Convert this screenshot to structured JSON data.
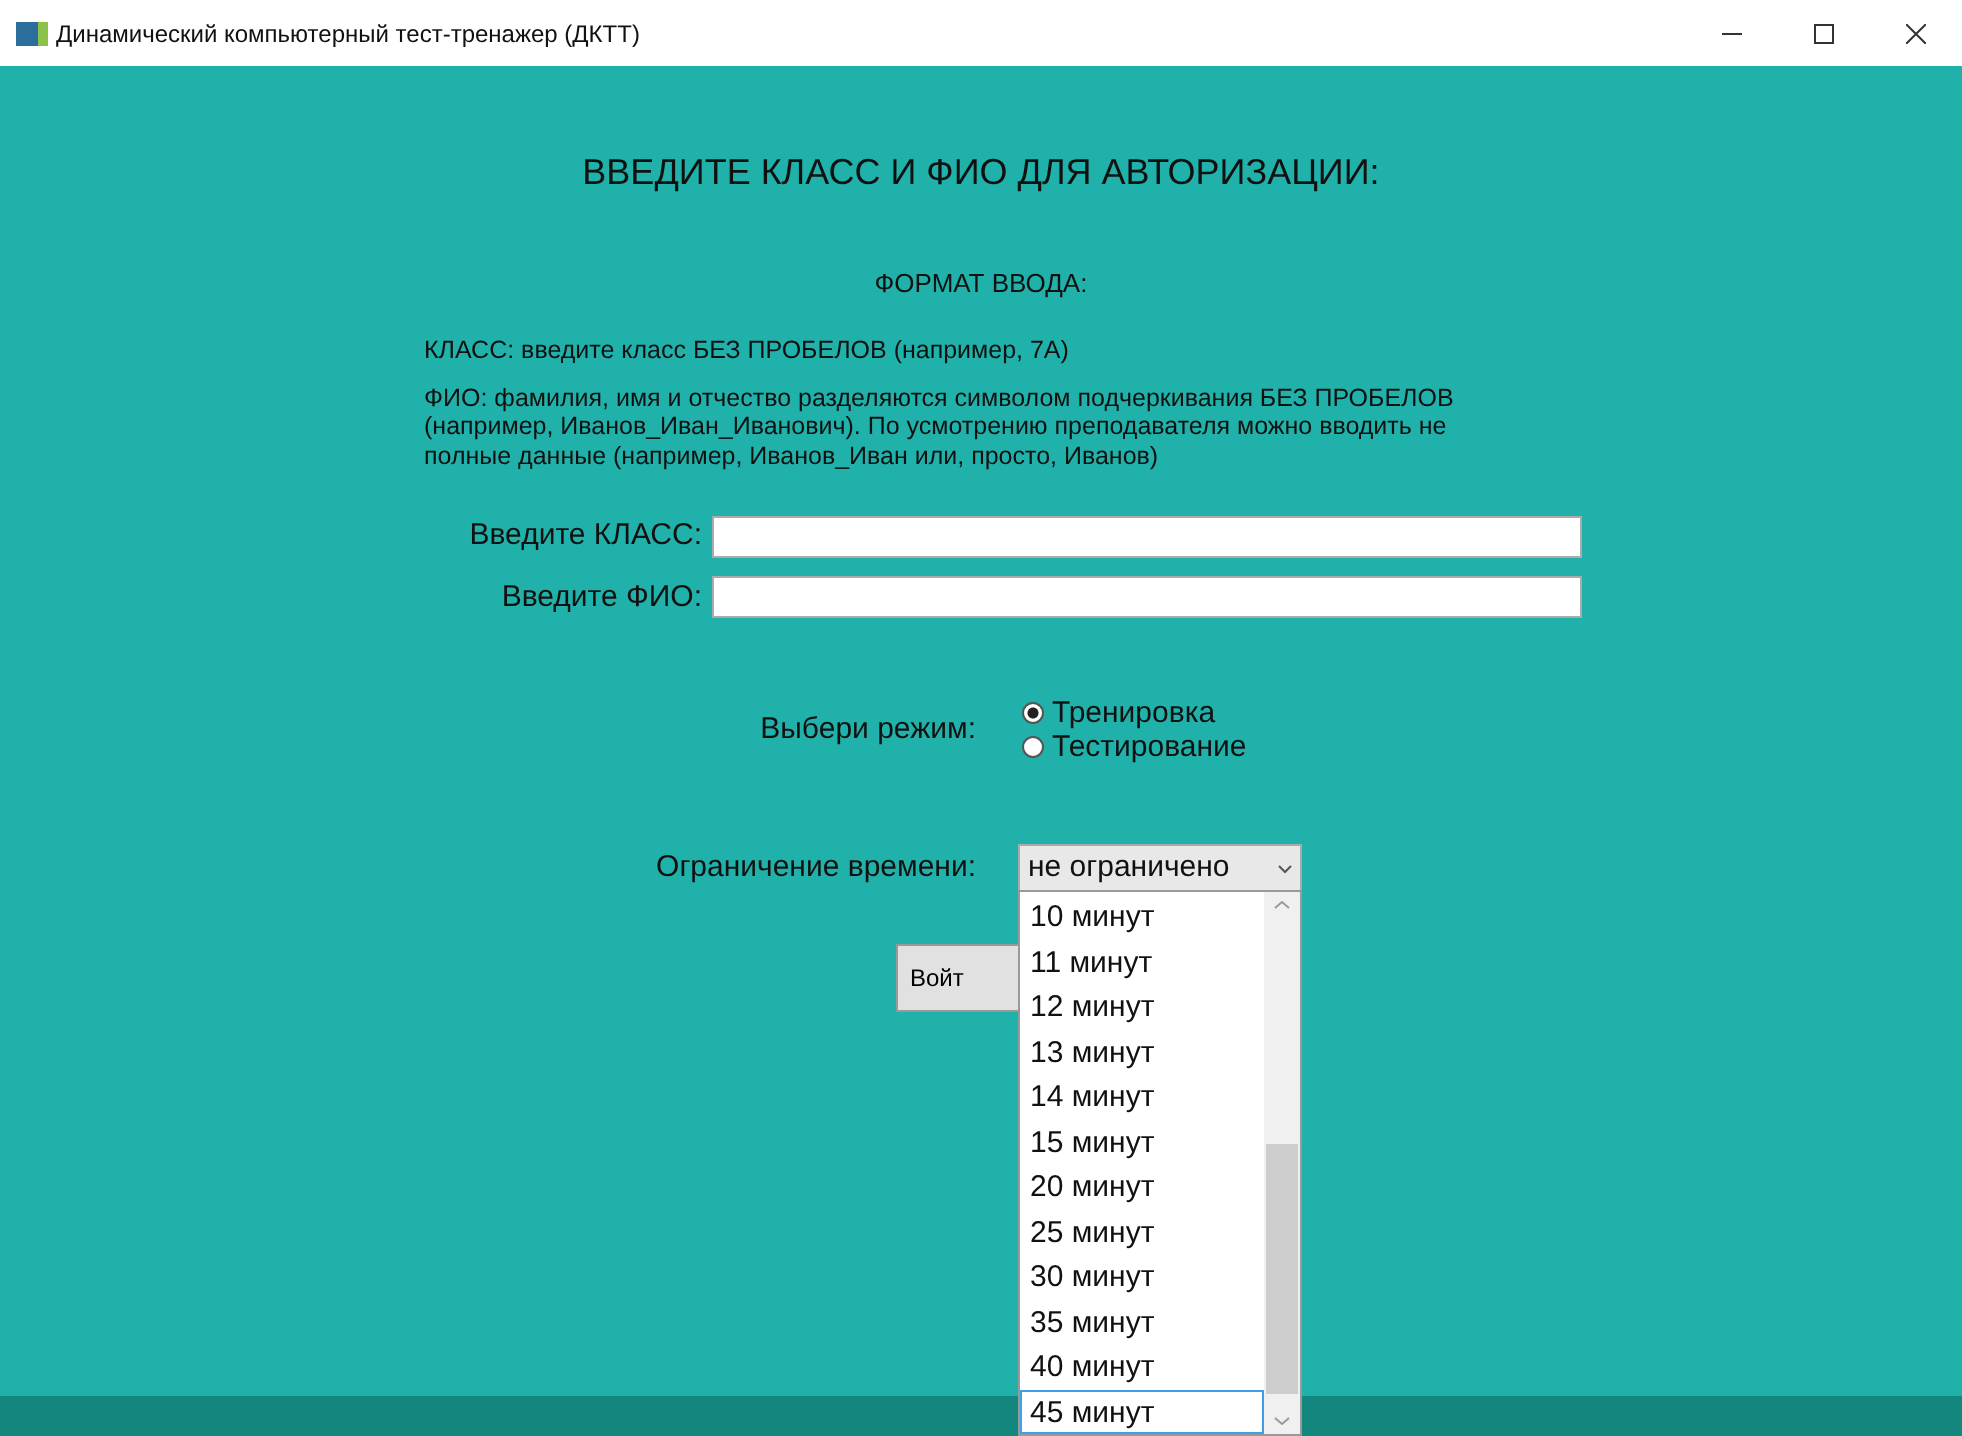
{
  "window": {
    "title": "Динамический компьютерный тест-тренажер (ДКТТ)"
  },
  "heading": "ВВЕДИТЕ КЛАСС И ФИО ДЛЯ АВТОРИЗАЦИИ:",
  "format_title": "ФОРМАТ ВВОДА:",
  "format_notes": [
    "КЛАСС: введите класс БЕЗ ПРОБЕЛОВ (например, 7А)",
    "ФИО: фамилия, имя и отчество разделяются символом подчеркивания БЕЗ ПРОБЕЛОВ (например, Иванов_Иван_Иванович). По усмотрению преподавателя можно вводить не полные данные (например, Иванов_Иван или, просто, Иванов)"
  ],
  "fields": [
    {
      "label": "Введите КЛАСС:"
    },
    {
      "label": "Введите ФИО:"
    }
  ],
  "mode": {
    "label": "Выбери режим:",
    "options": [
      {
        "label": "Тренировка",
        "selected": true
      },
      {
        "label": "Тестирование",
        "selected": false
      }
    ]
  },
  "time_limit": {
    "label": "Ограничение времени:",
    "value": "не ограничено",
    "expanded": true,
    "options": [
      {
        "label": "10 минут",
        "highlighted": false
      },
      {
        "label": "11 минут",
        "highlighted": false
      },
      {
        "label": "12 минут",
        "highlighted": false
      },
      {
        "label": "13 минут",
        "highlighted": false
      },
      {
        "label": "14 минут",
        "highlighted": false
      },
      {
        "label": "15 минут",
        "highlighted": false
      },
      {
        "label": "20 минут",
        "highlighted": false
      },
      {
        "label": "25 минут",
        "highlighted": false
      },
      {
        "label": "30 минут",
        "highlighted": false
      },
      {
        "label": "35 минут",
        "highlighted": false
      },
      {
        "label": "40 минут",
        "highlighted": false
      },
      {
        "label": "45 минут",
        "highlighted": true
      }
    ]
  },
  "login_button": "Войт"
}
